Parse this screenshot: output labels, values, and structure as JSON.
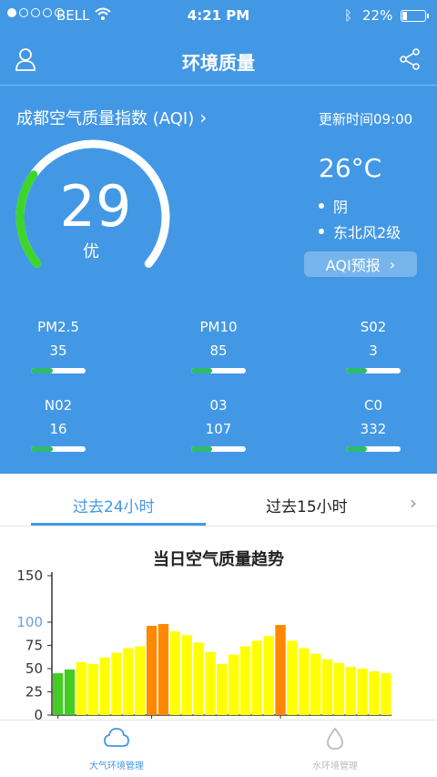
{
  "status_bar": {
    "carrier": "BELL",
    "time": "4:21 PM",
    "battery": "22%",
    "signal_icon": "signal-dots-icon",
    "wifi_icon": "wifi-icon",
    "bluetooth_icon": "bluetooth-icon"
  },
  "nav": {
    "title": "环境质量",
    "left_icon": "user-icon",
    "right_icon": "share-icon"
  },
  "aqi": {
    "title": "成都空气质量指数 (AQI)",
    "update_time": "更新时间09:00",
    "value": "29",
    "level": "优",
    "gauge_fraction": 0.29
  },
  "weather": {
    "temperature": "26°C",
    "condition": "阴",
    "wind": "东北风2级",
    "forecast_button": "AQI预报"
  },
  "pollutants": [
    {
      "name": "PM2.5",
      "value": "35",
      "fraction": 0.4
    },
    {
      "name": "PM10",
      "value": "85",
      "fraction": 0.38
    },
    {
      "name": "S02",
      "value": "3",
      "fraction": 0.38
    },
    {
      "name": "N02",
      "value": "16",
      "fraction": 0.4
    },
    {
      "name": "03",
      "value": "107",
      "fraction": 0.38
    },
    {
      "name": "C0",
      "value": "332",
      "fraction": 0.38
    }
  ],
  "tabs": {
    "active": "过去24小时",
    "other": "过去15小时"
  },
  "chart_data": {
    "type": "bar",
    "title": "当日空气质量趋势",
    "ylim": [
      0,
      150
    ],
    "yticks": [
      0,
      25,
      50,
      75,
      100,
      150
    ],
    "highlight_tick": 100,
    "values": [
      45,
      49,
      57,
      55,
      62,
      67,
      72,
      74,
      96,
      98,
      90,
      86,
      78,
      68,
      55,
      65,
      74,
      80,
      85,
      97,
      80,
      72,
      66,
      60,
      56,
      52,
      50,
      47,
      45
    ],
    "colors": [
      "#44cc22",
      "#44cc22",
      "#ffff00",
      "#ffff00",
      "#ffff00",
      "#ffff00",
      "#ffff00",
      "#ffff00",
      "#ff8800",
      "#ff8800",
      "#ffff00",
      "#ffff00",
      "#ffff00",
      "#ffff00",
      "#ffff00",
      "#ffff00",
      "#ffff00",
      "#ffff00",
      "#ffff00",
      "#ff8800",
      "#ffff00",
      "#ffff00",
      "#ffff00",
      "#ffff00",
      "#ffff00",
      "#ffff00",
      "#ffff00",
      "#ffff00",
      "#ffff00"
    ]
  },
  "bottom_tabs": [
    {
      "label": "大气环境管理",
      "icon": "cloud-icon"
    },
    {
      "label": "水环境管理",
      "icon": "water-icon"
    }
  ],
  "colors": {
    "primary": "#4398e5",
    "gauge_green": "#3dd52a",
    "good_green": "#44cc22",
    "moderate_yellow": "#ffff00",
    "orange": "#ff8800"
  }
}
